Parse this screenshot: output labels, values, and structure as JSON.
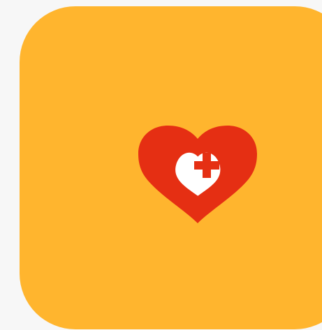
{
  "colors": {
    "background": "#f7f7f7",
    "tile": "#ffb52e",
    "heart_outer": "#e52f13",
    "heart_inner": "#ffffff",
    "cross": "#e52f13"
  },
  "icon": {
    "name": "heart-with-medical-cross-icon"
  }
}
